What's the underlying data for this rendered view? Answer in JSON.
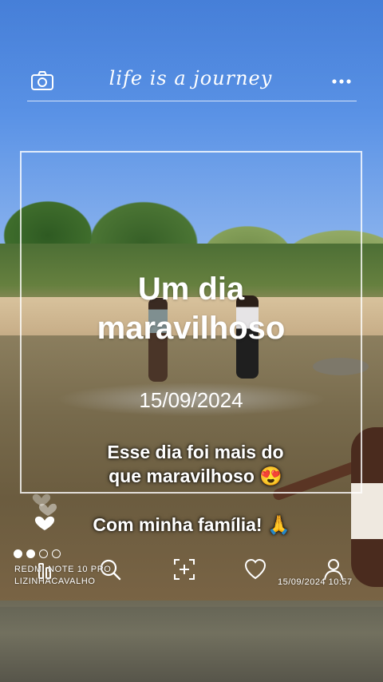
{
  "header": {
    "title": "life is a journey",
    "left_icon": "camera-icon",
    "right_icon": "more-dots-icon"
  },
  "card": {
    "headline_line1": "Um dia",
    "headline_line2": "maravilhoso",
    "date": "15/09/2024"
  },
  "captions": {
    "line1": "Esse dia foi mais do",
    "line2": "que maravilhoso 😍",
    "line3": "Com minha família! 🙏"
  },
  "page_indicator": {
    "count": 4,
    "active": [
      0,
      1
    ]
  },
  "watermark": {
    "device": "REDMI NOTE 10 PRO",
    "user": "LIZINHACAVALHO",
    "timestamp": "15/09/2024  10:57"
  },
  "bottom_icons": [
    "grid-icon",
    "search-icon",
    "add-square-icon",
    "heart-icon",
    "user-icon"
  ],
  "colors": {
    "sky": "#4a84dd",
    "text": "#ffffff"
  }
}
